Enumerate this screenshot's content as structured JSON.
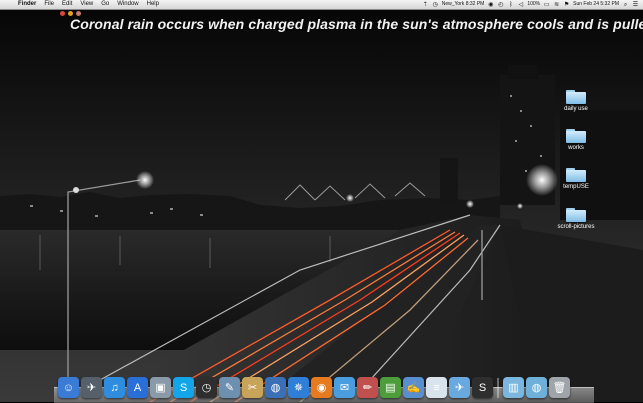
{
  "menubar": {
    "apple_icon": "apple-icon",
    "app_name": "Finder",
    "menus": [
      "File",
      "Edit",
      "View",
      "Go",
      "Window",
      "Help"
    ],
    "location_text": "New_York 8:32 PM",
    "battery_text": "100%",
    "clock_text": "Sun Feb 24 5:32 PM"
  },
  "headline": "Coronal rain occurs when charged plasma in the sun's atmosphere cools and is pulled",
  "desktop_icons": [
    {
      "label": "daily use"
    },
    {
      "label": "works"
    },
    {
      "label": "tempUSE"
    },
    {
      "label": "scroll-pictures"
    }
  ],
  "dock": {
    "items": [
      {
        "icon": "finder-icon",
        "color": "#3a7bd5",
        "glyph": "☺"
      },
      {
        "icon": "launchpad-icon",
        "color": "#55606a",
        "glyph": "✈"
      },
      {
        "icon": "itunes-icon",
        "color": "#2f8de0",
        "glyph": "♫"
      },
      {
        "icon": "app-store-icon",
        "color": "#2a6fd8",
        "glyph": "A"
      },
      {
        "icon": "preview-icon",
        "color": "#8a9aa8",
        "glyph": "▣"
      },
      {
        "icon": "skype-icon",
        "color": "#12a5e8",
        "glyph": "S"
      },
      {
        "icon": "dashboard-icon",
        "color": "#2e2e2e",
        "glyph": "◷"
      },
      {
        "icon": "preview-photo-icon",
        "color": "#6d8fb0",
        "glyph": "✎"
      },
      {
        "icon": "photo-tools-icon",
        "color": "#c8a35a",
        "glyph": "✂"
      },
      {
        "icon": "google-earth-icon",
        "color": "#3b6fb6",
        "glyph": "◍"
      },
      {
        "icon": "safari-icon",
        "color": "#2f7fd8",
        "glyph": "✵"
      },
      {
        "icon": "firefox-icon",
        "color": "#e57a1e",
        "glyph": "◉"
      },
      {
        "icon": "messages-icon",
        "color": "#4a9ee0",
        "glyph": "✉"
      },
      {
        "icon": "pencil-app-icon",
        "color": "#c0504d",
        "glyph": "✏"
      },
      {
        "icon": "numbers-icon",
        "color": "#4d9e3a",
        "glyph": "▤"
      },
      {
        "icon": "pages-icon",
        "color": "#5a8fcf",
        "glyph": "✍"
      },
      {
        "icon": "textedit-icon",
        "color": "#d9e3ee",
        "glyph": "≡"
      },
      {
        "icon": "mail-icon",
        "color": "#6aa8e0",
        "glyph": "✈"
      },
      {
        "icon": "system-prefs-icon",
        "color": "#2e2e2e",
        "glyph": "S"
      }
    ],
    "right_items": [
      {
        "icon": "documents-stack-icon",
        "color": "#7ab6dd",
        "glyph": "▥"
      },
      {
        "icon": "downloads-stack-icon",
        "color": "#6fb0da",
        "glyph": "◍"
      },
      {
        "icon": "trash-icon",
        "color": "#9ea4aa",
        "glyph": "🗑"
      }
    ]
  }
}
